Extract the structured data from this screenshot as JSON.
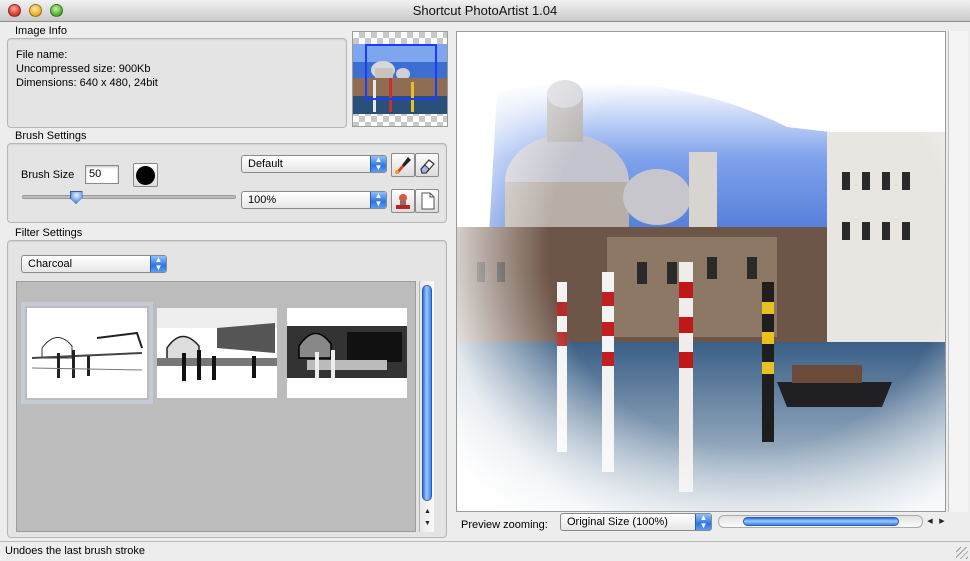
{
  "window": {
    "title": "Shortcut PhotoArtist 1.04"
  },
  "image_info": {
    "label": "Image Info",
    "file_name": "File name:",
    "uncompressed_size": "Uncompressed size: 900Kb",
    "dimensions": "Dimensions: 640 x 480, 24bit"
  },
  "brush_settings": {
    "label": "Brush Settings",
    "brush_size_label": "Brush Size",
    "brush_size_value": "50",
    "brush_color": "#000000",
    "slider_fraction": 0.25,
    "brush_preset": "Default",
    "opacity": "100%",
    "tools": [
      "brush-icon",
      "eraser-icon",
      "stamp-icon",
      "new-document-icon"
    ]
  },
  "filter_settings": {
    "label": "Filter Settings",
    "filter": "Charcoal",
    "selected_index": 0
  },
  "preview": {
    "zoom_label": "Preview zooming:",
    "zoom_value": "Original Size (100%)"
  },
  "status": {
    "text": "Undoes the last brush stroke"
  },
  "colors": {
    "accent": "#2f74e0",
    "sky": "#4f7fd8"
  }
}
